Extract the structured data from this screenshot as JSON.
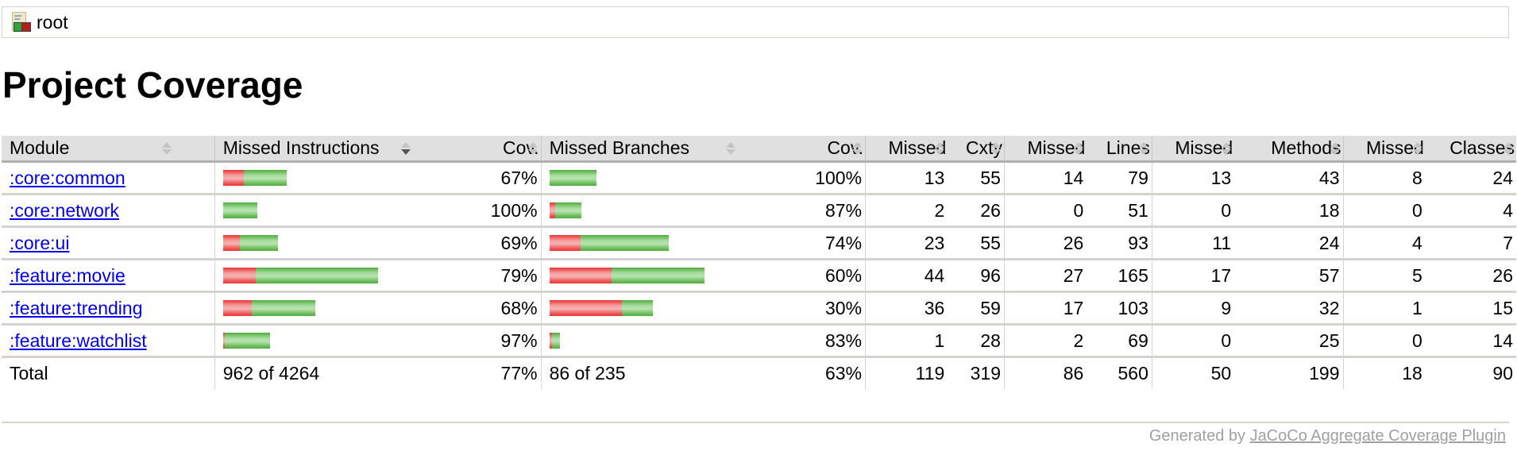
{
  "breadcrumb": {
    "icon": "report-icon",
    "label": "root"
  },
  "page_title": "Project Coverage",
  "table": {
    "headers": {
      "module": "Module",
      "missed_instructions": "Missed Instructions",
      "instr_cov": "Cov.",
      "missed_branches": "Missed Branches",
      "branch_cov": "Cov.",
      "missed_cxty": "Missed",
      "cxty": "Cxty",
      "missed_lines": "Missed",
      "lines": "Lines",
      "missed_methods": "Missed",
      "methods": "Methods",
      "missed_classes": "Missed",
      "classes": "Classes"
    },
    "sorted_column": "missed_instructions",
    "sort_direction": "descending",
    "rows": [
      {
        "module": ":core:common",
        "instr_missed_est": 275,
        "instr_covered_est": 560,
        "instr_cov": "67%",
        "branch_missed_est": 0,
        "branch_covered_est": 18,
        "branch_cov": "100%",
        "missed_cxty": "13",
        "cxty": "55",
        "missed_lines": "14",
        "lines": "79",
        "missed_methods": "13",
        "methods": "43",
        "missed_classes": "8",
        "classes": "24"
      },
      {
        "module": ":core:network",
        "instr_missed_est": 0,
        "instr_covered_est": 445,
        "instr_cov": "100%",
        "branch_missed_est": 2,
        "branch_covered_est": 10,
        "branch_cov": "87%",
        "missed_cxty": "2",
        "cxty": "26",
        "missed_lines": "0",
        "lines": "51",
        "missed_methods": "0",
        "methods": "18",
        "missed_classes": "0",
        "classes": "4"
      },
      {
        "module": ":core:ui",
        "instr_missed_est": 220,
        "instr_covered_est": 500,
        "instr_cov": "69%",
        "branch_missed_est": 12,
        "branch_covered_est": 34,
        "branch_cov": "74%",
        "missed_cxty": "23",
        "cxty": "55",
        "missed_lines": "26",
        "lines": "93",
        "missed_methods": "11",
        "methods": "24",
        "missed_classes": "4",
        "classes": "7"
      },
      {
        "module": ":feature:movie",
        "instr_missed_est": 425,
        "instr_covered_est": 1600,
        "instr_cov": "79%",
        "branch_missed_est": 24,
        "branch_covered_est": 36,
        "branch_cov": "60%",
        "missed_cxty": "44",
        "cxty": "96",
        "missed_lines": "27",
        "lines": "165",
        "missed_methods": "17",
        "methods": "57",
        "missed_classes": "5",
        "classes": "26"
      },
      {
        "module": ":feature:trending",
        "instr_missed_est": 375,
        "instr_covered_est": 830,
        "instr_cov": "68%",
        "branch_missed_est": 28,
        "branch_covered_est": 12,
        "branch_cov": "30%",
        "missed_cxty": "36",
        "cxty": "59",
        "missed_lines": "17",
        "lines": "103",
        "missed_methods": "9",
        "methods": "32",
        "missed_classes": "1",
        "classes": "15"
      },
      {
        "module": ":feature:watchlist",
        "instr_missed_est": 18,
        "instr_covered_est": 590,
        "instr_cov": "97%",
        "branch_missed_est": 1,
        "branch_covered_est": 3,
        "branch_cov": "83%",
        "missed_cxty": "1",
        "cxty": "28",
        "missed_lines": "2",
        "lines": "69",
        "missed_methods": "0",
        "methods": "25",
        "missed_classes": "0",
        "classes": "14"
      }
    ],
    "total": {
      "label": "Total",
      "missed_instructions": "962 of 4264",
      "instr_cov": "77%",
      "missed_branches": "86 of 235",
      "branch_cov": "63%",
      "missed_cxty": "119",
      "cxty": "319",
      "missed_lines": "86",
      "lines": "560",
      "missed_methods": "50",
      "methods": "199",
      "missed_classes": "18",
      "classes": "90"
    }
  },
  "footer": {
    "prefix": "Generated by ",
    "link_text": "JaCoCo Aggregate Coverage Plugin"
  },
  "colors": {
    "link": "#0000ee",
    "missed_bar": "#ee3333",
    "covered_bar": "#4fae3c",
    "header_bg": "#e0e0e0",
    "footer_text": "#a0a0a0"
  }
}
